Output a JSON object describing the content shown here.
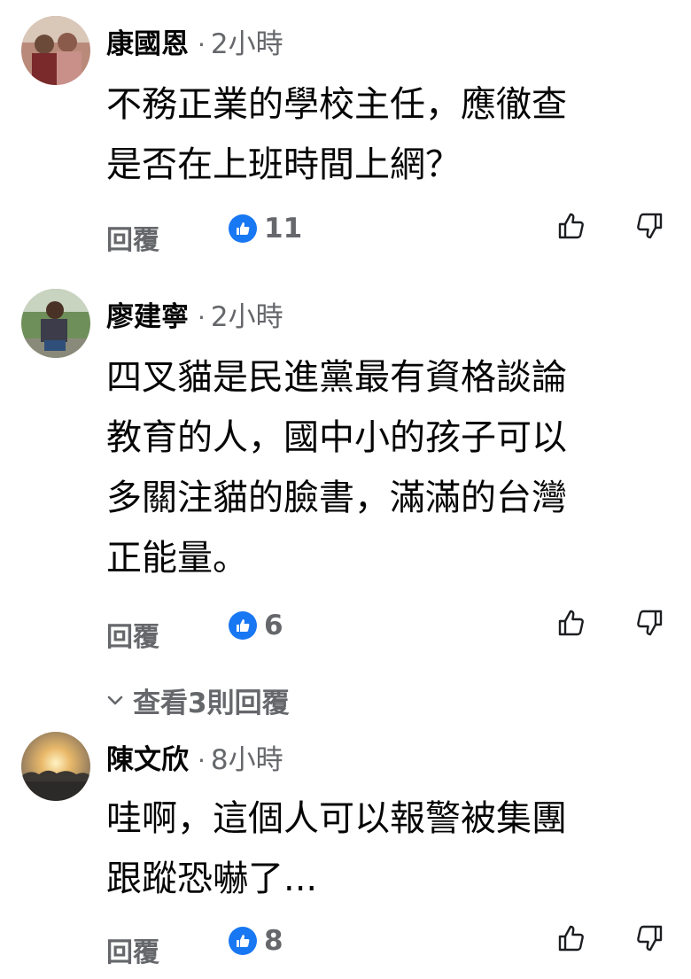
{
  "comments": [
    {
      "author": "康國恩",
      "separator": "·",
      "time": "2小時",
      "text": "不務正業的學校主任，應徹查\n是否在上班時間上網？",
      "reply_label": "回覆",
      "likes": "11"
    },
    {
      "author": "廖建寧",
      "separator": "·",
      "time": "2小時",
      "text": "四叉貓是民進黨最有資格談論\n教育的人，國中小的孩子可以\n多關注貓的臉書，滿滿的台灣\n正能量。",
      "reply_label": "回覆",
      "likes": "6"
    },
    {
      "author": "陳文欣",
      "separator": "·",
      "time": "8小時",
      "text": "哇啊，這個人可以報警被集團\n跟蹤恐嚇了...",
      "reply_label": "回覆",
      "likes": "8"
    }
  ],
  "view_replies": "查看3則回覆",
  "icons": {
    "like_badge": "thumbs-up-badge-icon",
    "upvote": "thumbs-up-outline-icon",
    "downvote": "thumbs-down-outline-icon",
    "expand": "chevron-down-icon"
  },
  "colors": {
    "accent": "#1877f2",
    "secondary_text": "#65676b",
    "primary_text": "#050505"
  }
}
